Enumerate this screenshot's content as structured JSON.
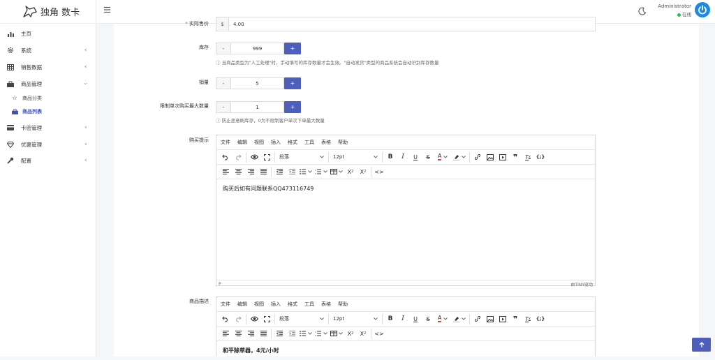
{
  "brand": {
    "name": "独角 数卡"
  },
  "sidebar": {
    "items": [
      {
        "label": "主页",
        "icon": "bar-chart-icon"
      },
      {
        "label": "系统",
        "icon": "gear-icon"
      },
      {
        "label": "销售数据",
        "icon": "table-icon"
      },
      {
        "label": "商品管理",
        "icon": "bag-icon"
      },
      {
        "label": "卡密管理",
        "icon": "card-icon"
      },
      {
        "label": "优惠管理",
        "icon": "diamond-icon"
      },
      {
        "label": "配置",
        "icon": "wrench-icon"
      }
    ],
    "sub_items": [
      {
        "label": "商品分类",
        "icon": "star-icon"
      },
      {
        "label": "商品列表",
        "icon": "bag-icon",
        "active": true
      }
    ],
    "chevron": "‹"
  },
  "header": {
    "admin_name": "Administrator",
    "status": "在线"
  },
  "form": {
    "price": {
      "label": "实际售价",
      "required": "*",
      "prefix": "$",
      "value": "4.00"
    },
    "stock": {
      "label": "库存",
      "value": "999",
      "minus": "-",
      "plus": "+",
      "hint": "当商品类型为\"人工处理\"时，手动填写的库存数量才会生效。\"自动发货\"类型的商品系统会自动识别库存数量"
    },
    "sales": {
      "label": "销量",
      "value": "5",
      "minus": "-",
      "plus": "+"
    },
    "limit": {
      "label": "限制单次购买最大数量",
      "value": "1",
      "minus": "-",
      "plus": "+",
      "hint": "防止恶意刷库存，0为不限制客户单次下单最大数量"
    },
    "buy_tip": {
      "label": "购买提示",
      "content": "购买后如有问题联系QQ473116749"
    },
    "desc": {
      "label": "商品描述",
      "content": "和平除草器，4元/小时"
    }
  },
  "editor": {
    "menus": [
      "文件",
      "编辑",
      "视图",
      "插入",
      "格式",
      "工具",
      "表格",
      "帮助"
    ],
    "block_format": "段落",
    "font_size": "12pt",
    "status_path": "P",
    "powered": "由TINY驱动"
  },
  "colors": {
    "accent": "#4e5fbb",
    "online": "#2eb85c",
    "avatar": "#1e88e5"
  }
}
